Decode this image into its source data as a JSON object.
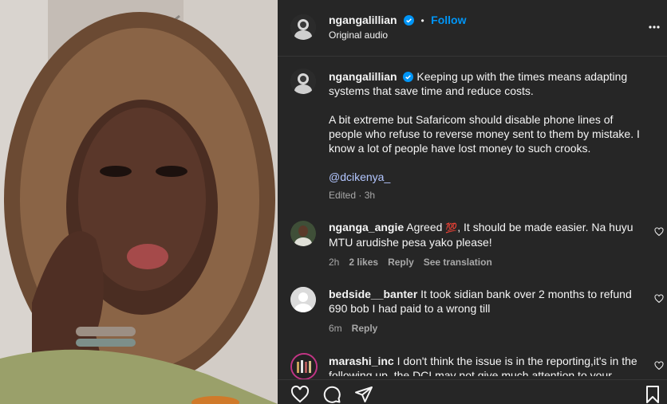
{
  "post": {
    "username": "ngangalillian",
    "follow": "Follow",
    "dot": "•",
    "audio": "Original audio",
    "caption_p1": "Keeping up with the times means adapting systems that save time and reduce costs.",
    "caption_p2": "A bit extreme but Safaricom should disable phone lines of people who refuse to reverse money sent to them by mistake. I know a lot of people have lost money to such crooks.",
    "mention": "@dcikenya_",
    "edited": "Edited · 3h"
  },
  "comments": [
    {
      "user": "nganga_angie",
      "text_a": "Agreed",
      "emoji": "💯",
      "text_b": ", It should be made easier. Na huyu MTU arudishe pesa yako please!",
      "time": "2h",
      "likes": "2 likes",
      "reply": "Reply",
      "translate": "See translation"
    },
    {
      "user": "bedside__banter",
      "text": "It took sidian bank over 2 months to refund 690 bob I had paid to a wrong till",
      "time": "6m",
      "reply": "Reply"
    },
    {
      "user": "marashi_inc",
      "text": "I don't think the issue is in the reporting,it's in the following up, the DCI may not give much attention to your"
    }
  ],
  "icons": [
    "more-icon",
    "verified-icon",
    "heart-icon",
    "comment-icon",
    "share-icon",
    "save-icon",
    "default-avatar-icon"
  ]
}
